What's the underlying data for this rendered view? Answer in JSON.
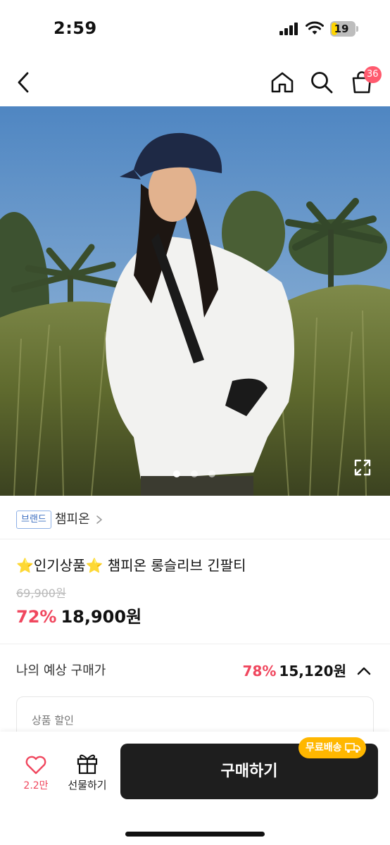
{
  "status_bar": {
    "time": "2:59",
    "battery": "19"
  },
  "nav": {
    "cart_count": "36"
  },
  "gallery": {
    "total_images": 3,
    "active_index": 0
  },
  "brand": {
    "badge": "브랜드",
    "name": "챔피온"
  },
  "product": {
    "title_star_left": "⭐",
    "title_text": "인기상품",
    "title_star_right": "⭐",
    "title_rest": " 챔피온 롱슬리브 긴팔티",
    "original_price": "69,900원",
    "discount": "72%",
    "price": "18,900원"
  },
  "estimate": {
    "label": "나의 예상 구매가",
    "discount": "78%",
    "price": "15,120원",
    "card_label": "상품 할인"
  },
  "bottom": {
    "like_count": "2.2만",
    "gift_label": "선물하기",
    "buy_label": "구매하기",
    "free_shipping": "무료배송"
  },
  "colors": {
    "accent": "#f0475e",
    "badge_blue": "#3d6fc0",
    "shipping": "#ffb700",
    "buy_button": "#1e1e1e"
  }
}
